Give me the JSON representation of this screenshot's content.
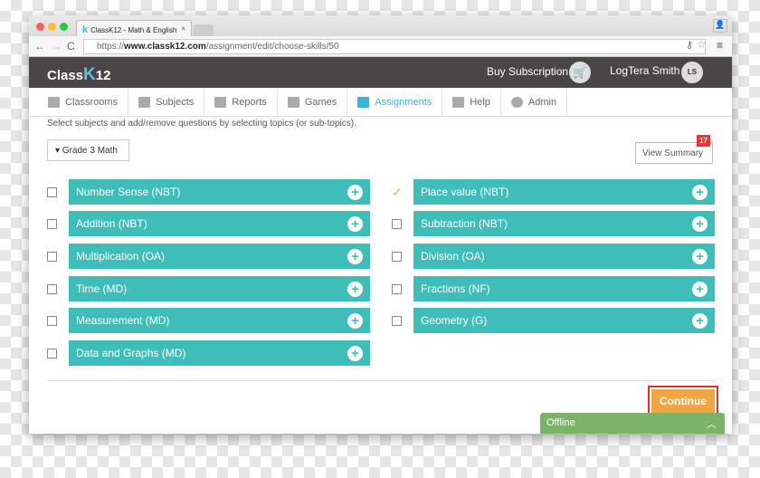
{
  "browser": {
    "tab_title": "ClassK12 - Math & English",
    "tab_close": "×",
    "url_prefix": "https://",
    "url_domain": "www.classk12.com",
    "url_path": "/assignment/edit/choose-skills/50"
  },
  "header": {
    "logo_a": "Class",
    "logo_k": "K",
    "logo_b": "12",
    "buy": "Buy Subscription",
    "user": "LogTera Smith",
    "initials": "LS"
  },
  "menu": [
    {
      "label": "Classrooms"
    },
    {
      "label": "Subjects"
    },
    {
      "label": "Reports"
    },
    {
      "label": "Games"
    },
    {
      "label": "Assignments",
      "active": true
    },
    {
      "label": "Help"
    },
    {
      "label": "Admin"
    }
  ],
  "instructions": "Select subjects and add/remove questions by selecting topics (or sub-topics).",
  "grade": "Grade 3 Math",
  "view_summary": "View Summary",
  "summary_count": "17",
  "left_topics": [
    {
      "label": "Number Sense (NBT)",
      "checked": false
    },
    {
      "label": "Addition (NBT)",
      "checked": false
    },
    {
      "label": "Multiplication (OA)",
      "checked": false
    },
    {
      "label": "Time (MD)",
      "checked": false
    },
    {
      "label": "Measurement (MD)",
      "checked": false
    },
    {
      "label": "Data and Graphs (MD)",
      "checked": false
    }
  ],
  "right_topics": [
    {
      "label": "Place value (NBT)",
      "checked": true
    },
    {
      "label": "Subtraction (NBT)",
      "checked": false
    },
    {
      "label": "Division (OA)",
      "checked": false
    },
    {
      "label": "Fractions (NF)",
      "checked": false
    },
    {
      "label": "Geometry (G)",
      "checked": false
    }
  ],
  "continue": "Continue",
  "offline": "Offline",
  "colors": {
    "tile": "#3fbdb9",
    "header": "#4a4546",
    "accent": "#3ab4d8",
    "continue": "#f0a540",
    "offline": "#7bb369",
    "badge": "#e33333"
  }
}
